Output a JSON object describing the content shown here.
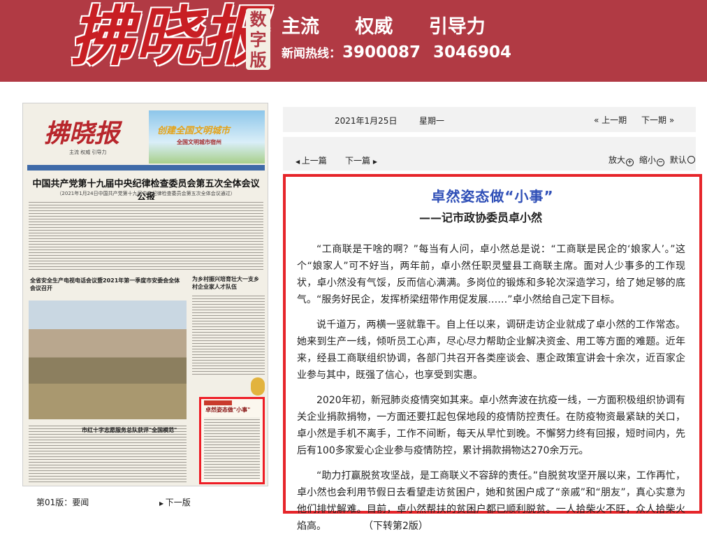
{
  "header": {
    "logo": "拂晓报",
    "badge": "数字版",
    "slogans": [
      "主流",
      "权威",
      "引导力"
    ],
    "hotline_label": "新闻热线：",
    "hotline_numbers": [
      "3900087",
      "3046904"
    ]
  },
  "paper_preview": {
    "logo": "拂晓报",
    "slogan": "主流  权威  引导力",
    "banner_title": "创建全国文明城市",
    "banner_sub": "全国文明城市宿州",
    "headline": "中国共产党第十九届中央纪律检查委员会第五次全体会议公报",
    "subhead": "（2021年1月24日中国共产党第十九届中央纪律检查委员会第五次全体会议通过）",
    "left_headline": "全省安全生产电视电话会议暨2021年第一季度市安委会全体会议召开",
    "right_headline": "为乡村振兴培育壮大一支乡村企业家人才队伍",
    "thumb_headline": "卓然姿态做\"小事\"",
    "bottom_headline": "市红十字志愿服务总队获评\"全国模范\""
  },
  "page_footer": {
    "page_label": "第01版：要闻",
    "next_page": "下一版"
  },
  "datebar": {
    "date": "2021年1月25日",
    "weekday": "星期一",
    "prev": "上一期",
    "next": "下一期"
  },
  "navbar": {
    "prev": "上一篇",
    "next": "下一篇",
    "zoom_in": "放大",
    "zoom_out": "缩小",
    "default": "默认"
  },
  "article": {
    "title": "卓然姿态做“小事”",
    "subtitle": "——记市政协委员卓小然",
    "paragraphs": [
      "“工商联是干啥的啊？”每当有人问，卓小然总是说：“工商联是民企的‘娘家人’。”这个“娘家人”可不好当，两年前，卓小然任职灵璧县工商联主席。面对人少事多的工作现状，卓小然没有气馁，反而信心满满。多岗位的锻炼和多轮次深造学习，给了她足够的底气。“服务好民企，发挥桥梁纽带作用促发展……”卓小然给自己定下目标。",
      "说千道万，两横一竖就靠干。自上任以来，调研走访企业就成了卓小然的工作常态。她来到生产一线，倾听员工心声，尽心尽力帮助企业解决资金、用工等方面的难题。近年来，经县工商联组织协调，各部门共召开各类座谈会、惠企政策宣讲会十余次，近百家企业参与其中，既强了信心，也享受到实惠。",
      "2020年初，新冠肺炎疫情突如其来。卓小然奔波在抗疫一线，一方面积极组织协调有关企业捐款捐物，一方面还要扛起包保地段的疫情防控责任。在防疫物资最紧缺的关口，卓小然是手机不离手，工作不间断，每天从早忙到晚。不懈努力终有回报，短时间内，先后有100多家爱心企业参与疫情防控，累计捐款捐物达270余万元。",
      "“助力打赢脱贫攻坚战，是工商联义不容辞的责任。”自脱贫攻坚开展以来，工作再忙，卓小然也会利用节假日去看望走访贫困户，她和贫困户成了“亲戚”和“朋友”，真心实意为他们排忧解难。目前，卓小然帮扶的贫困户都已顺利脱贫。一人拾柴火不旺，众人拾柴火焰高。"
    ],
    "continue_note": "（下转第2版）"
  }
}
